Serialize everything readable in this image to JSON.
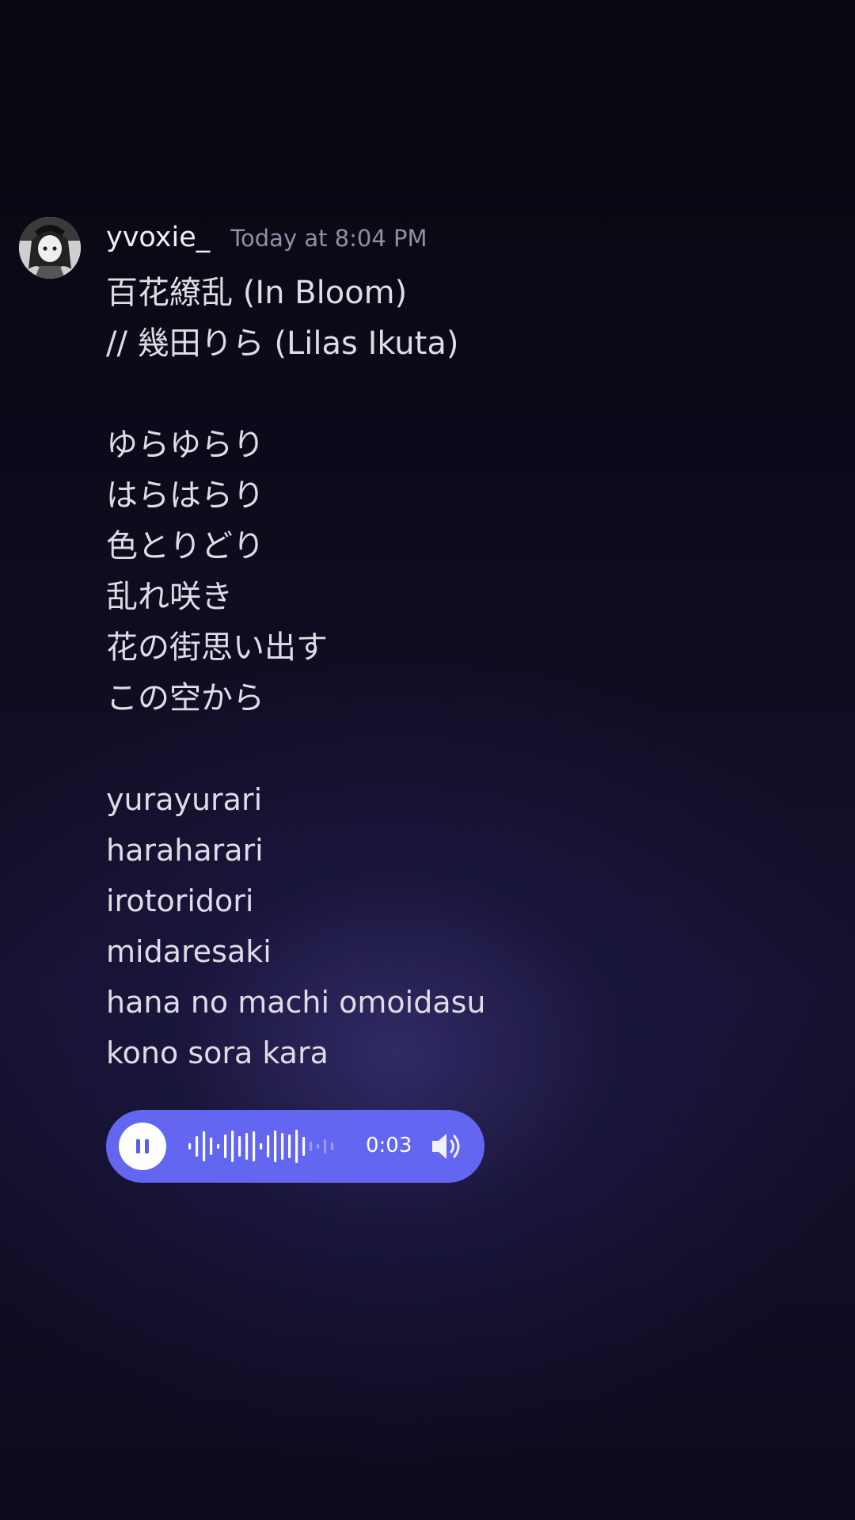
{
  "message": {
    "username": "yvoxie_",
    "timestamp": "Today at 8:04 PM",
    "title_lines": [
      "百花繚乱 (In Bloom)",
      "// 幾田りら (Lilas Ikuta)"
    ],
    "japanese_lines": [
      "ゆらゆらり",
      "はらはらり",
      "色とりどり",
      "乱れ咲き",
      "花の街思い出す",
      "この空から"
    ],
    "romaji_lines": [
      "yurayurari",
      "haraharari",
      "irotoridori",
      "midaresaki",
      "hana no machi omoidasu",
      "kono sora kara"
    ]
  },
  "audio_player": {
    "state": "playing",
    "play_icon": "pause-icon",
    "duration": "0:03",
    "progress": 0.8,
    "volume_icon": "speaker-icon",
    "accent_color": "#6366f0"
  }
}
